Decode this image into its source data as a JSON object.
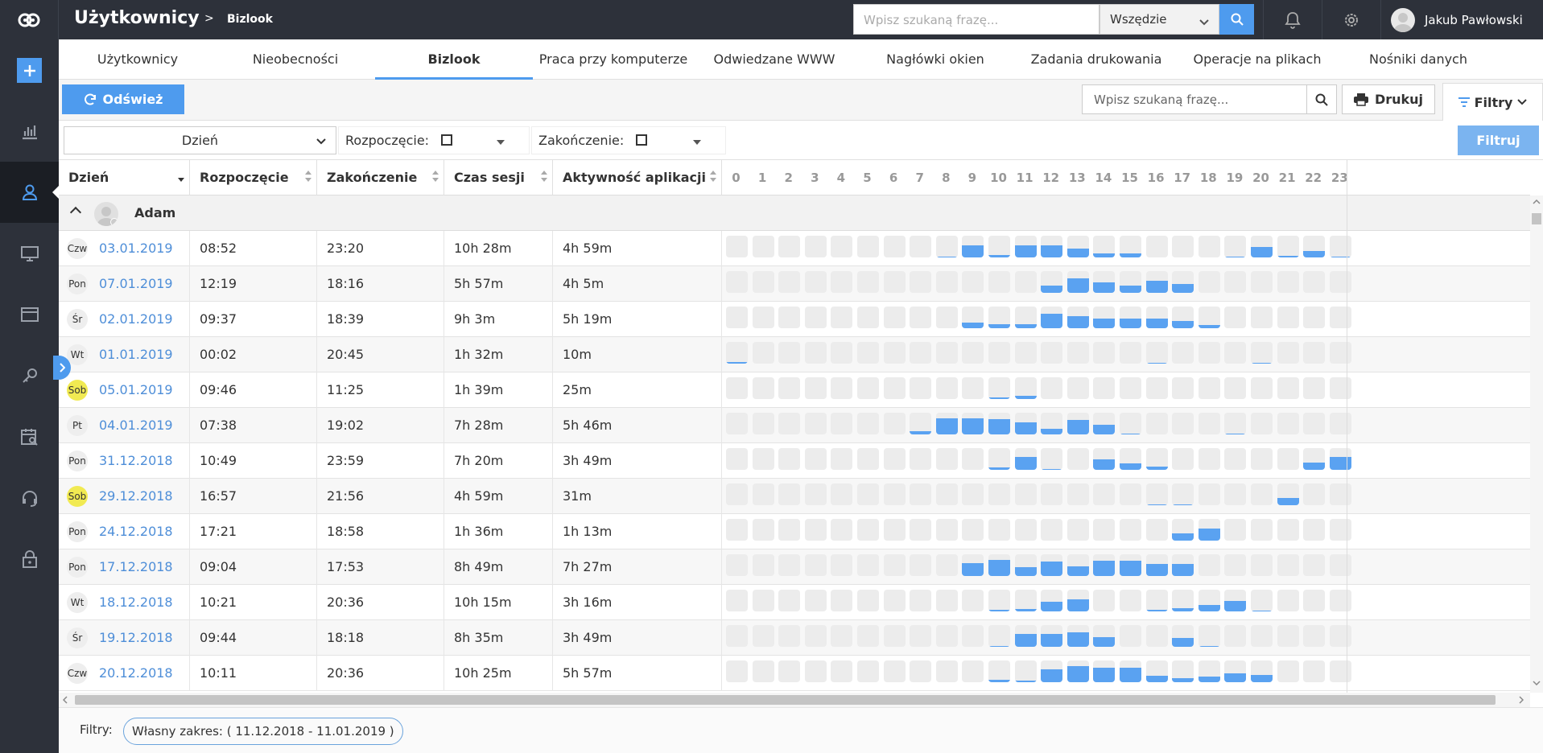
{
  "topbar": {
    "title": "Użytkownicy",
    "separator": ">",
    "breadcrumb": "Bizlook",
    "search_placeholder": "Wpisz szukaną frazę...",
    "scope": "Wszędzie",
    "user_name": "Jakub Pawłowski"
  },
  "colors": {
    "accent": "#4e9bee",
    "bar": "#5aa2f1",
    "saturday": "#f1ea52",
    "sidebar": "#2d313a"
  },
  "sidebar": {
    "items": [
      {
        "icon": "plus-icon"
      },
      {
        "icon": "bar-chart-icon"
      },
      {
        "icon": "user-icon"
      },
      {
        "icon": "monitor-icon"
      },
      {
        "icon": "window-icon"
      },
      {
        "icon": "key-icon"
      },
      {
        "icon": "calendar-search-icon"
      },
      {
        "icon": "headset-icon"
      },
      {
        "icon": "lock-icon"
      }
    ]
  },
  "tabs": [
    "Użytkownicy",
    "Nieobecności",
    "Bizlook",
    "Praca przy komputerze",
    "Odwiedzane WWW",
    "Nagłówki okien",
    "Zadania drukowania",
    "Operacje na plikach",
    "Nośniki danych"
  ],
  "toolbar": {
    "refresh": "Odśwież",
    "search_placeholder": "Wpisz szukaną frazę...",
    "print": "Drukuj",
    "filters": "Filtry"
  },
  "filterbar": {
    "grouping": "Dzień",
    "start_label": "Rozpoczęcie:",
    "end_label": "Zakończenie:",
    "apply": "Filtruj"
  },
  "table": {
    "columns": [
      "Dzień",
      "Rozpoczęcie",
      "Zakończenie",
      "Czas sesji",
      "Aktywność aplikacji"
    ],
    "hours": [
      "0",
      "1",
      "2",
      "3",
      "4",
      "5",
      "6",
      "7",
      "8",
      "9",
      "10",
      "11",
      "12",
      "13",
      "14",
      "15",
      "16",
      "17",
      "18",
      "19",
      "20",
      "21",
      "22",
      "23"
    ],
    "group": "Adam",
    "rows": [
      {
        "dow": "Czw",
        "sat": false,
        "date": "03.01.2019",
        "start": "08:52",
        "end": "23:20",
        "session": "10h 28m",
        "activity": "4h 59m",
        "levels": [
          0,
          0,
          0,
          0,
          0,
          0,
          0,
          0,
          0.05,
          0.55,
          0.1,
          0.55,
          0.55,
          0.4,
          0.2,
          0.2,
          0,
          0,
          0,
          0.03,
          0.5,
          0.06,
          0.3,
          0.05
        ]
      },
      {
        "dow": "Pon",
        "sat": false,
        "date": "07.01.2019",
        "start": "12:19",
        "end": "18:16",
        "session": "5h 57m",
        "activity": "4h 5m",
        "levels": [
          0,
          0,
          0,
          0,
          0,
          0,
          0,
          0,
          0,
          0,
          0,
          0,
          0.35,
          0.65,
          0.5,
          0.35,
          0.55,
          0.4,
          0,
          0,
          0,
          0,
          0,
          0
        ]
      },
      {
        "dow": "Śr",
        "sat": false,
        "date": "02.01.2019",
        "start": "09:37",
        "end": "18:39",
        "session": "9h 3m",
        "activity": "5h 19m",
        "levels": [
          0,
          0,
          0,
          0,
          0,
          0,
          0,
          0,
          0,
          0.25,
          0.2,
          0.2,
          0.65,
          0.55,
          0.45,
          0.45,
          0.45,
          0.35,
          0.15,
          0,
          0,
          0,
          0,
          0
        ]
      },
      {
        "dow": "Wt",
        "sat": false,
        "date": "01.01.2019",
        "start": "00:02",
        "end": "20:45",
        "session": "1h 32m",
        "activity": "10m",
        "levels": [
          0.07,
          0,
          0,
          0,
          0,
          0,
          0,
          0,
          0,
          0,
          0,
          0,
          0,
          0,
          0,
          0,
          0.03,
          0,
          0,
          0,
          0.04,
          0,
          0,
          0
        ]
      },
      {
        "dow": "Sob",
        "sat": true,
        "date": "05.01.2019",
        "start": "09:46",
        "end": "11:25",
        "session": "1h 39m",
        "activity": "25m",
        "levels": [
          0,
          0,
          0,
          0,
          0,
          0,
          0,
          0,
          0,
          0,
          0.08,
          0.15,
          0,
          0,
          0,
          0,
          0,
          0,
          0,
          0,
          0,
          0,
          0,
          0
        ]
      },
      {
        "dow": "Pt",
        "sat": false,
        "date": "04.01.2019",
        "start": "07:38",
        "end": "19:02",
        "session": "7h 28m",
        "activity": "5h 46m",
        "levels": [
          0,
          0,
          0,
          0,
          0,
          0,
          0,
          0.15,
          0.75,
          0.75,
          0.7,
          0.55,
          0.25,
          0.65,
          0.45,
          0.04,
          0,
          0,
          0,
          0.04,
          0,
          0,
          0,
          0
        ]
      },
      {
        "dow": "Pon",
        "sat": false,
        "date": "31.12.2018",
        "start": "10:49",
        "end": "23:59",
        "session": "7h 20m",
        "activity": "3h 49m",
        "levels": [
          0,
          0,
          0,
          0,
          0,
          0,
          0,
          0,
          0,
          0,
          0.12,
          0.6,
          0.04,
          0,
          0.5,
          0.3,
          0.15,
          0,
          0,
          0,
          0,
          0,
          0.35,
          0.6
        ]
      },
      {
        "dow": "Sob",
        "sat": true,
        "date": "29.12.2018",
        "start": "16:57",
        "end": "21:56",
        "session": "4h 59m",
        "activity": "31m",
        "levels": [
          0,
          0,
          0,
          0,
          0,
          0,
          0,
          0,
          0,
          0,
          0,
          0,
          0,
          0,
          0,
          0,
          0.03,
          0.03,
          0,
          0,
          0,
          0.35,
          0,
          0
        ]
      },
      {
        "dow": "Pon",
        "sat": false,
        "date": "24.12.2018",
        "start": "17:21",
        "end": "18:58",
        "session": "1h 36m",
        "activity": "1h 13m",
        "levels": [
          0,
          0,
          0,
          0,
          0,
          0,
          0,
          0,
          0,
          0,
          0,
          0,
          0,
          0,
          0,
          0,
          0,
          0.35,
          0.55,
          0,
          0,
          0,
          0,
          0
        ]
      },
      {
        "dow": "Pon",
        "sat": false,
        "date": "17.12.2018",
        "start": "09:04",
        "end": "17:53",
        "session": "8h 49m",
        "activity": "7h 27m",
        "levels": [
          0,
          0,
          0,
          0,
          0,
          0,
          0,
          0,
          0,
          0.6,
          0.75,
          0.4,
          0.65,
          0.45,
          0.7,
          0.7,
          0.55,
          0.55,
          0,
          0,
          0,
          0,
          0,
          0
        ]
      },
      {
        "dow": "Wt",
        "sat": false,
        "date": "18.12.2018",
        "start": "10:21",
        "end": "20:36",
        "session": "10h 15m",
        "activity": "3h 16m",
        "levels": [
          0,
          0,
          0,
          0,
          0,
          0,
          0,
          0,
          0,
          0,
          0.08,
          0.1,
          0.45,
          0.55,
          0,
          0,
          0.08,
          0.15,
          0.3,
          0.5,
          0.03,
          0,
          0,
          0
        ]
      },
      {
        "dow": "Śr",
        "sat": false,
        "date": "19.12.2018",
        "start": "09:44",
        "end": "18:18",
        "session": "8h 35m",
        "activity": "3h 49m",
        "levels": [
          0,
          0,
          0,
          0,
          0,
          0,
          0,
          0,
          0,
          0,
          0.04,
          0.6,
          0.6,
          0.65,
          0.45,
          0,
          0,
          0.4,
          0.04,
          0,
          0,
          0,
          0,
          0
        ]
      },
      {
        "dow": "Czw",
        "sat": false,
        "date": "20.12.2018",
        "start": "10:11",
        "end": "20:36",
        "session": "10h 25m",
        "activity": "5h 57m",
        "levels": [
          0,
          0,
          0,
          0,
          0,
          0,
          0,
          0,
          0,
          0,
          0.1,
          0.06,
          0.6,
          0.75,
          0.65,
          0.65,
          0.3,
          0.2,
          0.25,
          0.4,
          0.35,
          0,
          0,
          0
        ]
      }
    ]
  },
  "footer": {
    "label": "Filtry:",
    "chip": "Własny zakres: ( 11.12.2018 - 11.01.2019 )"
  }
}
